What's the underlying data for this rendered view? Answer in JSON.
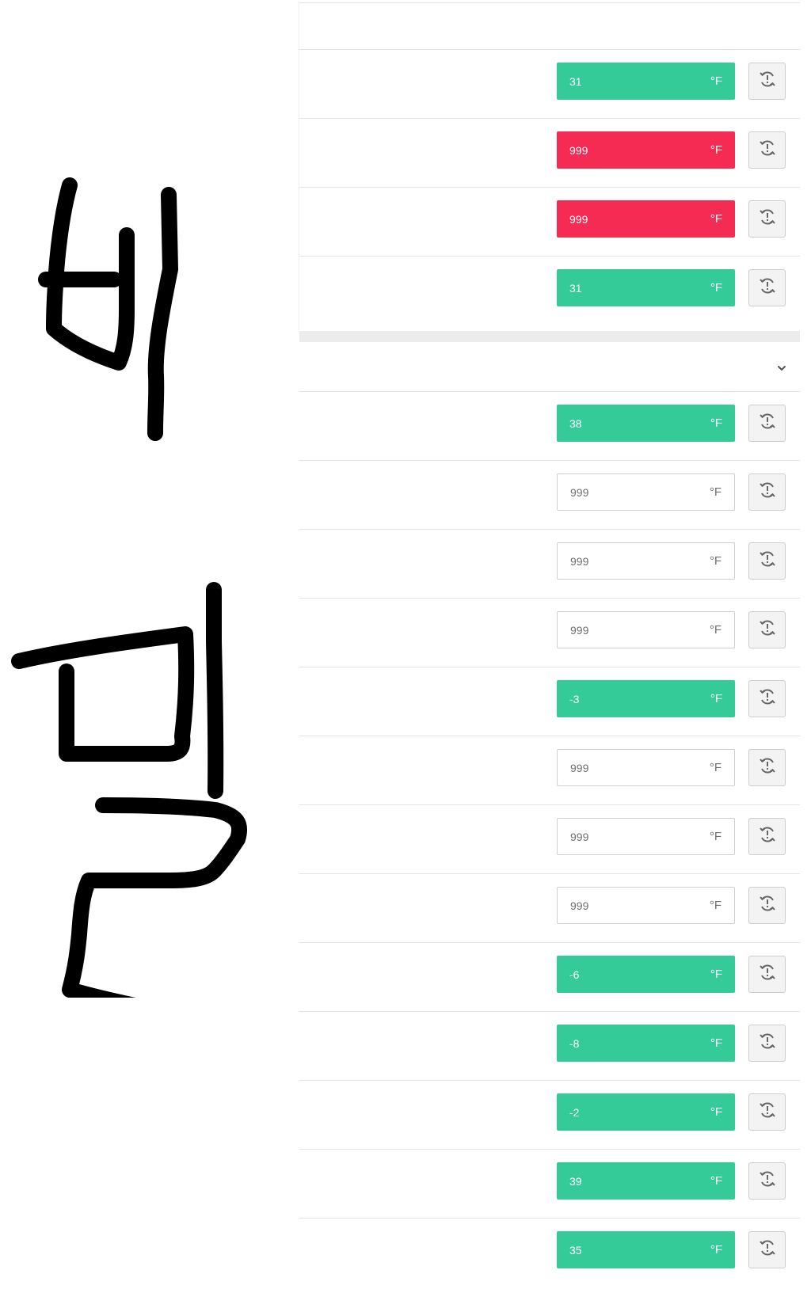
{
  "unit_label": "°F",
  "icon": "reset-warning-icon",
  "colors": {
    "ok": "#34cb98",
    "bad": "#f52b53",
    "empty_border": "#cfcfcf"
  },
  "section1": {
    "rows": [
      {
        "value": "31",
        "status": "ok"
      },
      {
        "value": "999",
        "status": "bad"
      },
      {
        "value": "999",
        "status": "bad"
      },
      {
        "value": "31",
        "status": "ok"
      }
    ]
  },
  "section2": {
    "toggle_icon": "chevron-down-icon",
    "rows": [
      {
        "value": "38",
        "status": "ok"
      },
      {
        "value": "999",
        "status": "empty"
      },
      {
        "value": "999",
        "status": "empty"
      },
      {
        "value": "999",
        "status": "empty"
      },
      {
        "value": "-3",
        "status": "ok"
      },
      {
        "value": "999",
        "status": "empty"
      },
      {
        "value": "999",
        "status": "empty"
      },
      {
        "value": "999",
        "status": "empty"
      },
      {
        "value": "-6",
        "status": "ok"
      },
      {
        "value": "-8",
        "status": "ok"
      },
      {
        "value": "-2",
        "status": "ok"
      },
      {
        "value": "39",
        "status": "ok"
      },
      {
        "value": "35",
        "status": "ok"
      }
    ]
  }
}
